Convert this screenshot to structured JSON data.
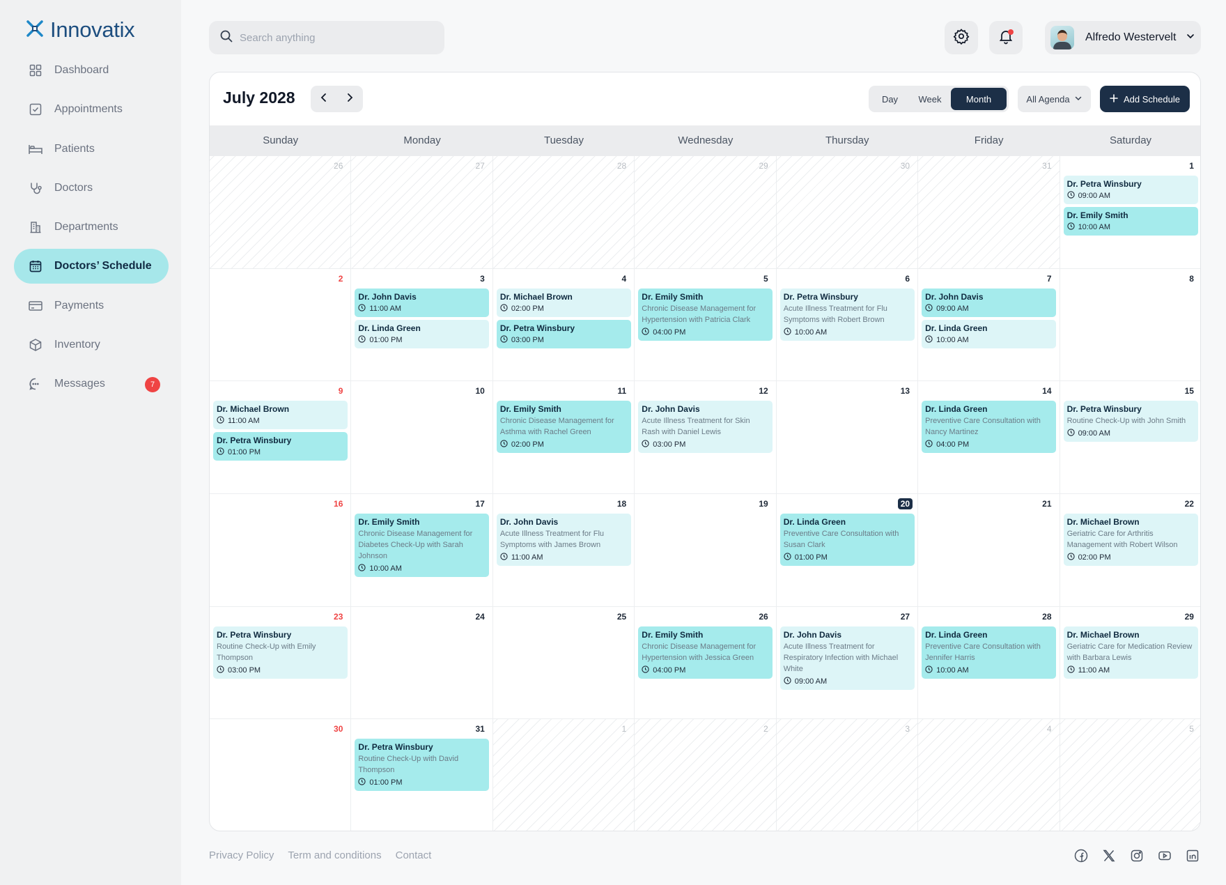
{
  "app": {
    "name": "Innovatix"
  },
  "sidebar": {
    "items": [
      {
        "label": "Dashboard",
        "icon": "dashboard-icon"
      },
      {
        "label": "Appointments",
        "icon": "appointments-icon"
      },
      {
        "label": "Patients",
        "icon": "bed-icon"
      },
      {
        "label": "Doctors",
        "icon": "stethoscope-icon"
      },
      {
        "label": "Departments",
        "icon": "building-icon"
      },
      {
        "label": "Doctors’ Schedule",
        "icon": "calendar-icon",
        "active": true
      },
      {
        "label": "Payments",
        "icon": "card-icon"
      },
      {
        "label": "Inventory",
        "icon": "box-icon"
      },
      {
        "label": "Messages",
        "icon": "chat-icon",
        "badge": "7"
      }
    ]
  },
  "header": {
    "search_placeholder": "Search anything",
    "user_name": "Alfredo Westervelt"
  },
  "calendar": {
    "title": "July 2028",
    "views": [
      "Day",
      "Week",
      "Month"
    ],
    "active_view": "Month",
    "agenda_filter": "All Agenda",
    "add_label": "Add Schedule",
    "weekdays": [
      "Sunday",
      "Monday",
      "Tuesday",
      "Wednesday",
      "Thursday",
      "Friday",
      "Saturday"
    ],
    "today": 20,
    "weeks": [
      [
        {
          "d": "26",
          "out": true
        },
        {
          "d": "27",
          "out": true
        },
        {
          "d": "28",
          "out": true
        },
        {
          "d": "29",
          "out": true
        },
        {
          "d": "30",
          "out": true
        },
        {
          "d": "31",
          "out": true
        },
        {
          "d": "1"
        }
      ],
      [
        {
          "d": "2"
        },
        {
          "d": "3"
        },
        {
          "d": "4"
        },
        {
          "d": "5"
        },
        {
          "d": "6"
        },
        {
          "d": "7"
        },
        {
          "d": "8"
        }
      ],
      [
        {
          "d": "9"
        },
        {
          "d": "10"
        },
        {
          "d": "11"
        },
        {
          "d": "12"
        },
        {
          "d": "13"
        },
        {
          "d": "14"
        },
        {
          "d": "15"
        }
      ],
      [
        {
          "d": "16"
        },
        {
          "d": "17"
        },
        {
          "d": "18"
        },
        {
          "d": "19"
        },
        {
          "d": "20"
        },
        {
          "d": "21"
        },
        {
          "d": "22"
        }
      ],
      [
        {
          "d": "23"
        },
        {
          "d": "24"
        },
        {
          "d": "25"
        },
        {
          "d": "26"
        },
        {
          "d": "27"
        },
        {
          "d": "28"
        },
        {
          "d": "29"
        }
      ],
      [
        {
          "d": "30"
        },
        {
          "d": "31"
        },
        {
          "d": "1",
          "out": true
        },
        {
          "d": "2",
          "out": true
        },
        {
          "d": "3",
          "out": true
        },
        {
          "d": "4",
          "out": true
        },
        {
          "d": "5",
          "out": true
        }
      ]
    ],
    "events": [
      {
        "day": 1,
        "doctor": "Dr. Petra Winsbury",
        "time": "09:00 AM",
        "style": "light"
      },
      {
        "day": 1,
        "doctor": "Dr. Emily Smith",
        "time": "10:00 AM",
        "style": "dark"
      },
      {
        "day": 3,
        "doctor": "Dr. John Davis",
        "time": "11:00 AM",
        "style": "dark"
      },
      {
        "day": 3,
        "doctor": "Dr. Linda Green",
        "time": "01:00 PM",
        "style": "light"
      },
      {
        "day": 4,
        "doctor": "Dr. Michael Brown",
        "time": "02:00 PM",
        "style": "light"
      },
      {
        "day": 4,
        "doctor": "Dr. Petra Winsbury",
        "time": "03:00 PM",
        "style": "dark"
      },
      {
        "day": 5,
        "doctor": "Dr. Emily Smith",
        "desc": "Chronic Disease Management for Hypertension with Patricia Clark",
        "time": "04:00 PM",
        "style": "dark"
      },
      {
        "day": 6,
        "doctor": "Dr. Petra Winsbury",
        "desc": "Acute Illness Treatment for Flu Symptoms with Robert Brown",
        "time": "10:00 AM",
        "style": "light"
      },
      {
        "day": 7,
        "doctor": "Dr. John Davis",
        "time": "09:00 AM",
        "style": "dark"
      },
      {
        "day": 7,
        "doctor": "Dr. Linda Green",
        "time": "10:00 AM",
        "style": "light"
      },
      {
        "day": 9,
        "doctor": "Dr. Michael Brown",
        "time": "11:00 AM",
        "style": "light"
      },
      {
        "day": 9,
        "doctor": "Dr. Petra Winsbury",
        "time": "01:00 PM",
        "style": "dark"
      },
      {
        "day": 11,
        "doctor": "Dr. Emily Smith",
        "desc": "Chronic Disease Management for Asthma with Rachel Green",
        "time": "02:00 PM",
        "style": "dark"
      },
      {
        "day": 12,
        "doctor": "Dr. John Davis",
        "desc": "Acute Illness Treatment for Skin Rash with Daniel Lewis",
        "time": "03:00 PM",
        "style": "light"
      },
      {
        "day": 14,
        "doctor": "Dr. Linda Green",
        "desc": "Preventive Care Consultation with Nancy Martinez",
        "time": "04:00 PM",
        "style": "dark"
      },
      {
        "day": 15,
        "doctor": "Dr. Petra Winsbury",
        "desc": "Routine Check-Up with John Smith",
        "time": "09:00 AM",
        "style": "light"
      },
      {
        "day": 17,
        "doctor": "Dr. Emily Smith",
        "desc": "Chronic Disease Management for Diabetes Check-Up with Sarah Johnson",
        "time": "10:00 AM",
        "style": "dark"
      },
      {
        "day": 18,
        "doctor": "Dr. John Davis",
        "desc": "Acute Illness Treatment for Flu Symptoms with James Brown",
        "time": "11:00 AM",
        "style": "light"
      },
      {
        "day": 20,
        "doctor": "Dr. Linda Green",
        "desc": "Preventive Care Consultation with Susan Clark",
        "time": "01:00 PM",
        "style": "dark"
      },
      {
        "day": 22,
        "doctor": "Dr. Michael Brown",
        "desc": "Geriatric Care for Arthritis Management with Robert Wilson",
        "time": "02:00 PM",
        "style": "light"
      },
      {
        "day": 23,
        "doctor": "Dr. Petra Winsbury",
        "desc": "Routine Check-Up with Emily Thompson",
        "time": "03:00 PM",
        "style": "light"
      },
      {
        "day": 26,
        "doctor": "Dr. Emily Smith",
        "desc": "Chronic Disease Management for Hypertension with Jessica Green",
        "time": "04:00 PM",
        "style": "dark"
      },
      {
        "day": 27,
        "doctor": "Dr. John Davis",
        "desc": "Acute Illness Treatment for Respiratory Infection with Michael White",
        "time": "09:00 AM",
        "style": "light"
      },
      {
        "day": 28,
        "doctor": "Dr. Linda Green",
        "desc": "Preventive Care Consultation with Jennifer Harris",
        "time": "10:00 AM",
        "style": "dark"
      },
      {
        "day": 29,
        "doctor": "Dr. Michael Brown",
        "desc": "Geriatric Care for Medication Review with Barbara Lewis",
        "time": "11:00 AM",
        "style": "light"
      },
      {
        "day": 31,
        "doctor": "Dr. Petra Winsbury",
        "desc": "Routine Check-Up with David Thompson",
        "time": "01:00 PM",
        "style": "dark"
      }
    ]
  },
  "footer": {
    "links": [
      "Privacy Policy",
      "Term and conditions",
      "Contact"
    ],
    "social": [
      "facebook-icon",
      "x-icon",
      "instagram-icon",
      "youtube-icon",
      "linkedin-icon"
    ]
  },
  "colors": {
    "accent": "#a6e7ea",
    "brand": "#1d4e7f",
    "primary": "#1c2f47",
    "event_light": "#ddf5f7",
    "event_dark": "#a5ebec",
    "weekend_red": "#ef4444"
  }
}
